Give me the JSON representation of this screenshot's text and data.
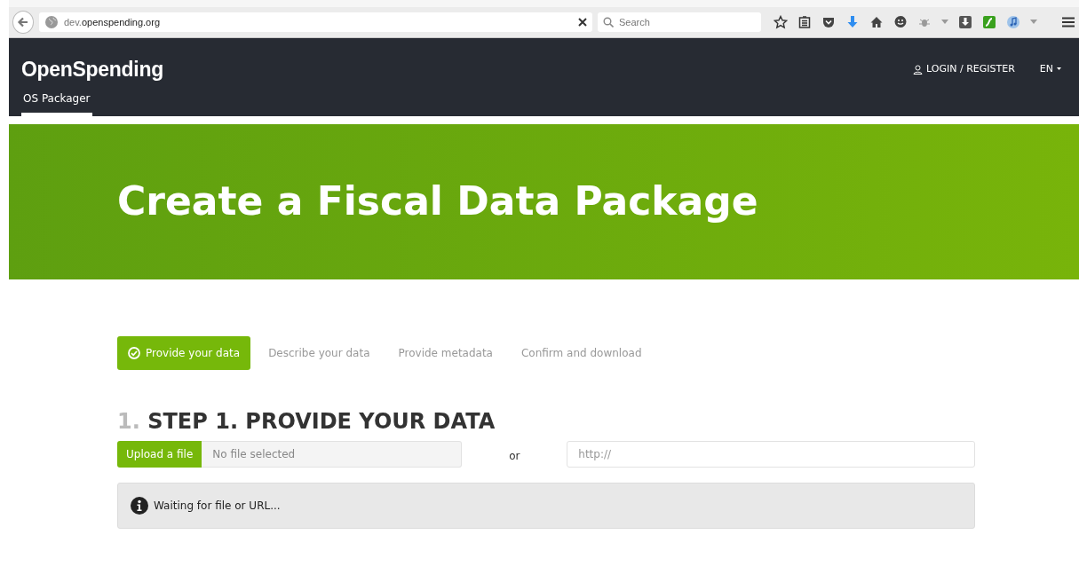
{
  "browser": {
    "url_subdomain": "dev.",
    "url_domain": "openspending.org",
    "search_placeholder": "Search"
  },
  "navbar": {
    "brand": "OpenSpending",
    "login": "LOGIN / REGISTER",
    "language": "EN",
    "tabs": [
      {
        "label": "OS Packager",
        "selected": true
      }
    ]
  },
  "hero": {
    "title": "Create a Fiscal Data Package"
  },
  "steps": [
    {
      "label": "Provide your data",
      "selected": true
    },
    {
      "label": "Describe your data",
      "selected": false
    },
    {
      "label": "Provide metadata",
      "selected": false
    },
    {
      "label": "Confirm and download",
      "selected": false
    }
  ],
  "section": {
    "number": "1.",
    "heading": "STEP 1. PROVIDE YOUR DATA"
  },
  "upload": {
    "button": "Upload a file",
    "file_status": "No file selected",
    "separator": "or",
    "url_placeholder": "http://"
  },
  "status_message": "Waiting for file or URL..."
}
